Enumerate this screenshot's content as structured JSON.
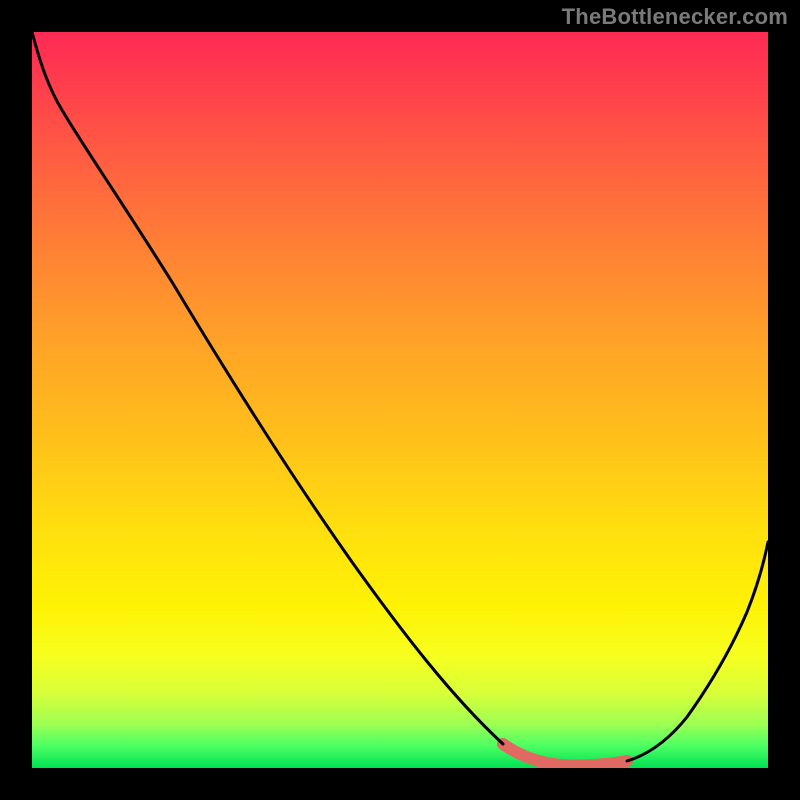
{
  "attribution": "TheBottlenecker.com",
  "chart_data": {
    "type": "line",
    "title": "",
    "xlabel": "",
    "ylabel": "",
    "xlim": [
      0,
      100
    ],
    "ylim": [
      0,
      100
    ],
    "series": [
      {
        "name": "main-curve",
        "color": "#000000",
        "x": [
          0,
          4,
          10,
          20,
          30,
          40,
          50,
          58,
          62,
          66,
          70,
          74,
          78,
          84,
          90,
          96,
          100
        ],
        "y": [
          100,
          97,
          90,
          75,
          60,
          45,
          30,
          18,
          11,
          6,
          2,
          0,
          0,
          2,
          10,
          22,
          32
        ]
      },
      {
        "name": "highlight-segment",
        "color": "#e06a61",
        "x": [
          62,
          66,
          70,
          74,
          78
        ],
        "y": [
          11,
          6,
          2,
          0,
          0
        ]
      }
    ],
    "gradient_stops": [
      {
        "pos": 0,
        "color": "#ff2a55"
      },
      {
        "pos": 16,
        "color": "#ff5a43"
      },
      {
        "pos": 42,
        "color": "#ffa228"
      },
      {
        "pos": 68,
        "color": "#ffe00e"
      },
      {
        "pos": 85,
        "color": "#f6ff20"
      },
      {
        "pos": 100,
        "color": "#00e154"
      }
    ]
  }
}
